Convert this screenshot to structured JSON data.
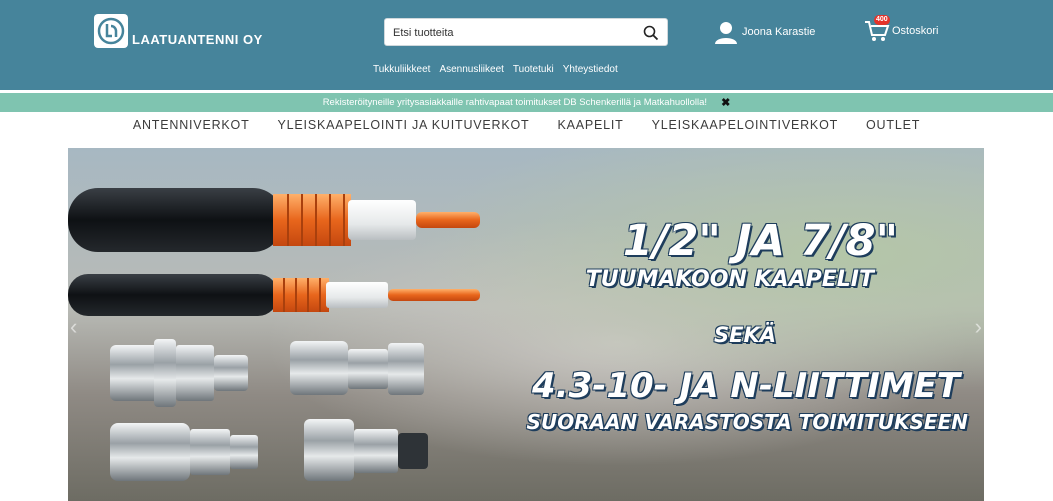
{
  "brand": {
    "name": "LAATUANTENNI OY"
  },
  "search": {
    "placeholder": "Etsi tuotteita"
  },
  "user": {
    "name": "Joona Karastie"
  },
  "cart": {
    "label": "Ostoskori",
    "badge": "400"
  },
  "subnav": [
    "Tukkuliikkeet",
    "Asennusliikeet",
    "Tuotetuki",
    "Yhteystiedot"
  ],
  "notice": {
    "text": "Rekisteröityneille yritysasiakkaille rahtivapaat toimitukset DB Schenkerillä ja Matkahuollolla!",
    "close": "✖"
  },
  "mainnav": [
    "ANTENNIVERKOT",
    "YLEISKAAPELOINTI JA KUITUVERKOT",
    "KAAPELIT",
    "YLEISKAAPELOINTIVERKOT",
    "OUTLET"
  ],
  "banner": {
    "line1": "1/2\" JA 7/8\"",
    "line2": "TUUMAKOON KAAPELIT",
    "line3": "SEKÄ",
    "line4": "4.3-10- JA N-LIITTIMET",
    "line5": "SUORAAN VARASTOSTA TOIMITUKSEEN",
    "prev": "‹",
    "next": "›"
  },
  "colors": {
    "header": "#46849b",
    "notice": "#7fc4b0",
    "badge": "#e5332a"
  }
}
